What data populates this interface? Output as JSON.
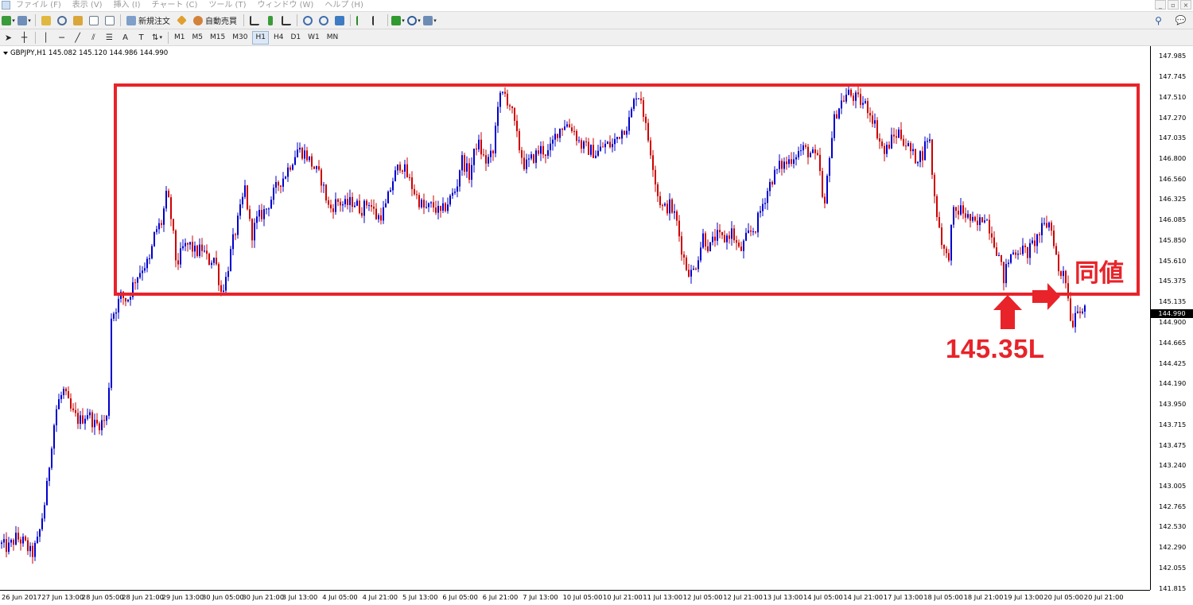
{
  "app": {
    "menu": [
      "ファイル (F)",
      "表示 (V)",
      "挿入 (I)",
      "チャート (C)",
      "ツール (T)",
      "ウィンドウ (W)",
      "ヘルプ (H)"
    ],
    "window_controls": [
      "_",
      "▫",
      "×"
    ]
  },
  "toolbar": {
    "new_order_label": "新規注文",
    "auto_trading_label": "自動売買"
  },
  "timeframes": [
    "M1",
    "M5",
    "M15",
    "M30",
    "H1",
    "H4",
    "D1",
    "W1",
    "MN"
  ],
  "active_timeframe": "H1",
  "chart": {
    "header": "GBPJPY,H1  145.082 145.120 144.986 144.990",
    "current_price_label": "144.990"
  },
  "annotations": {
    "same_price": "同値",
    "price_level": "145.35L"
  },
  "colors": {
    "bull": "#0000cc",
    "bear": "#cc0000",
    "annotation": "#e8232a"
  },
  "chart_data": {
    "type": "candlestick",
    "symbol": "GBPJPY",
    "timeframe": "H1",
    "ohlc_last": {
      "open": 145.082,
      "high": 145.12,
      "low": 144.986,
      "close": 144.99
    },
    "price_ticks": [
      "147.985",
      "147.745",
      "147.510",
      "147.270",
      "147.035",
      "146.800",
      "146.560",
      "146.325",
      "146.085",
      "145.850",
      "145.610",
      "145.375",
      "145.135",
      "144.900",
      "144.665",
      "144.425",
      "144.190",
      "143.950",
      "143.715",
      "143.475",
      "143.240",
      "143.005",
      "142.765",
      "142.530",
      "142.290",
      "142.055",
      "141.815"
    ],
    "time_ticks": [
      "26 Jun 2017",
      "27 Jun 13:00",
      "28 Jun 05:00",
      "28 Jun 21:00",
      "29 Jun 13:00",
      "30 Jun 05:00",
      "30 Jun 21:00",
      "3 Jul 13:00",
      "4 Jul 05:00",
      "4 Jul 21:00",
      "5 Jul 13:00",
      "6 Jul 05:00",
      "6 Jul 21:00",
      "7 Jul 13:00",
      "10 Jul 05:00",
      "10 Jul 21:00",
      "11 Jul 13:00",
      "12 Jul 05:00",
      "12 Jul 21:00",
      "13 Jul 13:00",
      "14 Jul 05:00",
      "14 Jul 21:00",
      "17 Jul 13:00",
      "18 Jul 05:00",
      "18 Jul 21:00",
      "19 Jul 13:00",
      "20 Jul 05:00",
      "20 Jul 21:00"
    ],
    "ylim": [
      141.815,
      147.985
    ],
    "close_path": [
      [
        0,
        142.33
      ],
      [
        10,
        142.28
      ],
      [
        20,
        142.4
      ],
      [
        30,
        142.35
      ],
      [
        40,
        142.2
      ],
      [
        48,
        142.38
      ],
      [
        58,
        142.9
      ],
      [
        66,
        143.6
      ],
      [
        72,
        143.95
      ],
      [
        80,
        144.1
      ],
      [
        90,
        143.85
      ],
      [
        100,
        143.75
      ],
      [
        110,
        143.85
      ],
      [
        120,
        143.7
      ],
      [
        130,
        143.75
      ],
      [
        136,
        143.8
      ],
      [
        139,
        144.95
      ],
      [
        145,
        145.05
      ],
      [
        152,
        145.2
      ],
      [
        160,
        145.15
      ],
      [
        170,
        145.4
      ],
      [
        180,
        145.55
      ],
      [
        188,
        145.6
      ],
      [
        195,
        145.95
      ],
      [
        203,
        146.05
      ],
      [
        210,
        146.4
      ],
      [
        216,
        146.05
      ],
      [
        222,
        145.55
      ],
      [
        230,
        145.75
      ],
      [
        238,
        145.8
      ],
      [
        246,
        145.7
      ],
      [
        254,
        145.75
      ],
      [
        262,
        145.6
      ],
      [
        270,
        145.65
      ],
      [
        278,
        145.25
      ],
      [
        284,
        145.4
      ],
      [
        292,
        145.8
      ],
      [
        300,
        146.1
      ],
      [
        308,
        146.45
      ],
      [
        316,
        145.9
      ],
      [
        324,
        146.1
      ],
      [
        334,
        146.2
      ],
      [
        342,
        146.35
      ],
      [
        350,
        146.5
      ],
      [
        358,
        146.6
      ],
      [
        366,
        146.75
      ],
      [
        374,
        146.9
      ],
      [
        384,
        146.85
      ],
      [
        394,
        146.7
      ],
      [
        404,
        146.55
      ],
      [
        414,
        146.2
      ],
      [
        424,
        146.3
      ],
      [
        434,
        146.25
      ],
      [
        444,
        146.3
      ],
      [
        454,
        146.2
      ],
      [
        464,
        146.3
      ],
      [
        474,
        146.1
      ],
      [
        484,
        146.2
      ],
      [
        494,
        146.55
      ],
      [
        504,
        146.75
      ],
      [
        514,
        146.55
      ],
      [
        524,
        146.35
      ],
      [
        534,
        146.2
      ],
      [
        544,
        146.25
      ],
      [
        554,
        146.15
      ],
      [
        564,
        146.3
      ],
      [
        574,
        146.45
      ],
      [
        580,
        146.8
      ],
      [
        590,
        146.6
      ],
      [
        600,
        147.0
      ],
      [
        610,
        146.75
      ],
      [
        620,
        146.85
      ],
      [
        626,
        147.45
      ],
      [
        634,
        147.55
      ],
      [
        642,
        147.4
      ],
      [
        652,
        146.95
      ],
      [
        660,
        146.7
      ],
      [
        670,
        146.8
      ],
      [
        680,
        146.9
      ],
      [
        690,
        146.85
      ],
      [
        700,
        147.1
      ],
      [
        710,
        147.2
      ],
      [
        720,
        147.15
      ],
      [
        730,
        146.95
      ],
      [
        740,
        146.9
      ],
      [
        750,
        146.85
      ],
      [
        760,
        146.95
      ],
      [
        770,
        146.95
      ],
      [
        780,
        147.1
      ],
      [
        790,
        147.2
      ],
      [
        800,
        147.55
      ],
      [
        806,
        147.5
      ],
      [
        812,
        147.15
      ],
      [
        820,
        146.8
      ],
      [
        826,
        146.4
      ],
      [
        834,
        146.2
      ],
      [
        842,
        146.25
      ],
      [
        850,
        146.1
      ],
      [
        856,
        145.8
      ],
      [
        862,
        145.55
      ],
      [
        870,
        145.45
      ],
      [
        876,
        145.6
      ],
      [
        884,
        145.9
      ],
      [
        892,
        145.75
      ],
      [
        900,
        145.9
      ],
      [
        910,
        145.85
      ],
      [
        920,
        145.95
      ],
      [
        930,
        145.7
      ],
      [
        940,
        145.9
      ],
      [
        950,
        146.0
      ],
      [
        960,
        146.3
      ],
      [
        970,
        146.55
      ],
      [
        980,
        146.7
      ],
      [
        990,
        146.75
      ],
      [
        1000,
        146.85
      ],
      [
        1010,
        146.9
      ],
      [
        1020,
        146.85
      ],
      [
        1030,
        146.75
      ],
      [
        1036,
        146.1
      ],
      [
        1042,
        146.8
      ],
      [
        1050,
        147.3
      ],
      [
        1058,
        147.45
      ],
      [
        1066,
        147.55
      ],
      [
        1074,
        147.5
      ],
      [
        1082,
        147.45
      ],
      [
        1090,
        147.4
      ],
      [
        1098,
        147.25
      ],
      [
        1106,
        147.0
      ],
      [
        1112,
        146.85
      ],
      [
        1120,
        147.0
      ],
      [
        1130,
        147.1
      ],
      [
        1140,
        146.95
      ],
      [
        1150,
        146.8
      ],
      [
        1160,
        146.85
      ],
      [
        1168,
        147.1
      ],
      [
        1174,
        146.4
      ],
      [
        1180,
        146.05
      ],
      [
        1186,
        145.75
      ],
      [
        1192,
        145.6
      ],
      [
        1198,
        146.15
      ],
      [
        1208,
        146.2
      ],
      [
        1218,
        146.1
      ],
      [
        1228,
        146.0
      ],
      [
        1238,
        146.15
      ],
      [
        1248,
        145.9
      ],
      [
        1256,
        145.65
      ],
      [
        1262,
        145.4
      ],
      [
        1266,
        145.55
      ],
      [
        1272,
        145.7
      ],
      [
        1282,
        145.75
      ],
      [
        1292,
        145.7
      ],
      [
        1302,
        145.85
      ],
      [
        1312,
        146.0
      ],
      [
        1320,
        146.05
      ],
      [
        1326,
        145.8
      ],
      [
        1332,
        145.4
      ],
      [
        1338,
        145.55
      ],
      [
        1344,
        145.1
      ],
      [
        1348,
        144.85
      ],
      [
        1354,
        145.1
      ],
      [
        1360,
        145.05
      ],
      [
        1366,
        144.99
      ]
    ]
  }
}
